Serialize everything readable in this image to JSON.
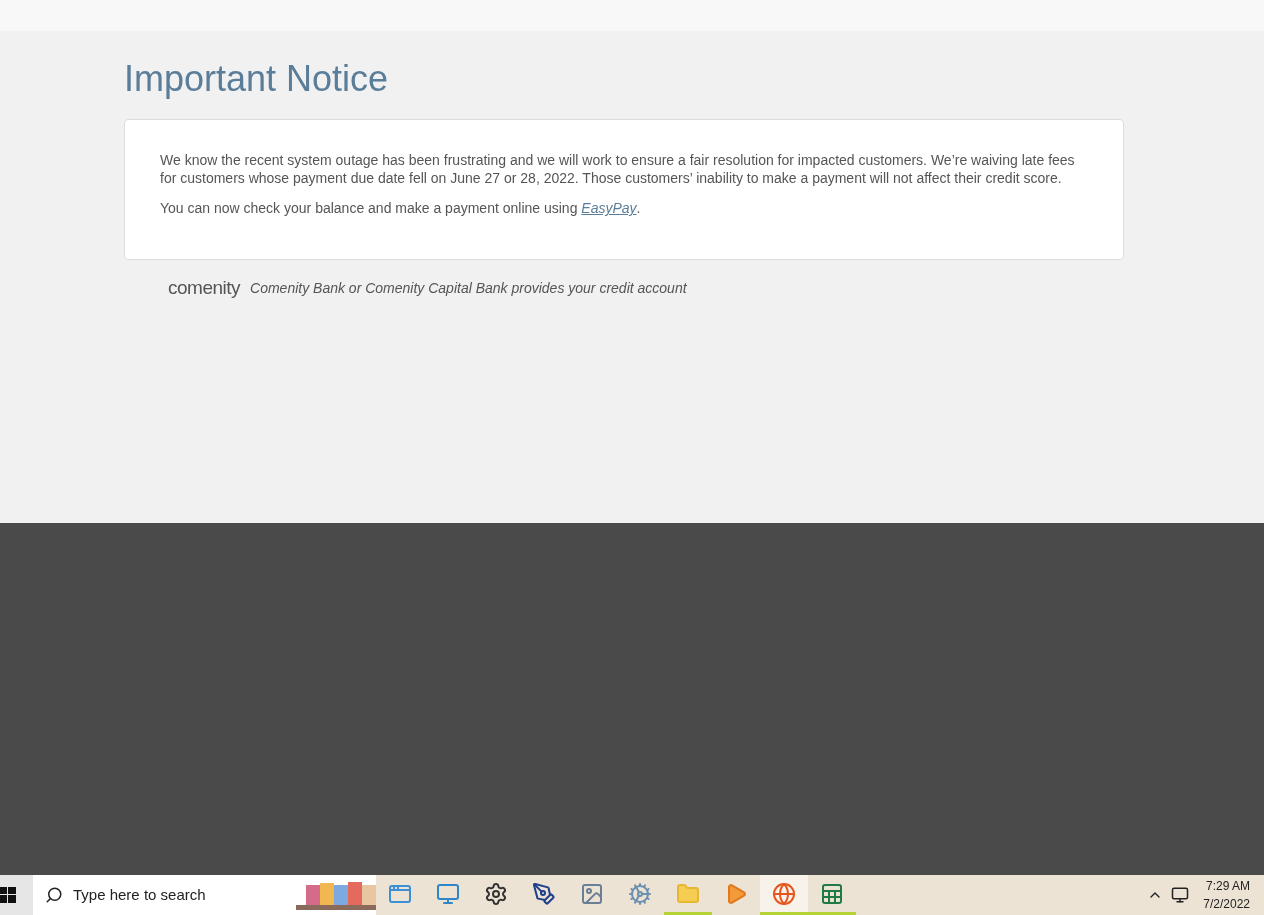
{
  "page": {
    "title": "Important Notice",
    "notice": {
      "paragraphs": [
        {
          "text": "We know the recent system outage has been frustrating and we will work to ensure a fair resolution for impacted customers. We’re waiving late fees for customers whose payment due date fell on June 27 or 28, 2022. Those customers’ inability to make a payment will not affect their credit score."
        },
        {
          "text": "You can now check your balance and make a payment online using ",
          "link": "EasyPay",
          "after": "."
        }
      ]
    },
    "footer": {
      "logo": "comenity",
      "text": "Comenity Bank or Comenity Capital Bank provides your credit account"
    }
  },
  "taskbar": {
    "search": {
      "placeholder": "Type here to search"
    },
    "apps": [
      {
        "kind": "window",
        "running": false,
        "selected": false
      },
      {
        "kind": "screen",
        "running": false,
        "selected": false
      },
      {
        "kind": "gear",
        "running": false,
        "selected": false
      },
      {
        "kind": "pen",
        "running": false,
        "selected": false
      },
      {
        "kind": "monitor",
        "running": false,
        "selected": false
      },
      {
        "kind": "gears",
        "running": false,
        "selected": false
      },
      {
        "kind": "folder",
        "running": true,
        "selected": false
      },
      {
        "kind": "media",
        "running": false,
        "selected": false
      },
      {
        "kind": "browser",
        "running": true,
        "selected": true
      },
      {
        "kind": "spreadsheet",
        "running": true,
        "selected": false
      }
    ],
    "clock": {
      "time": "7:29 AM",
      "date": "7/2/2022"
    }
  }
}
